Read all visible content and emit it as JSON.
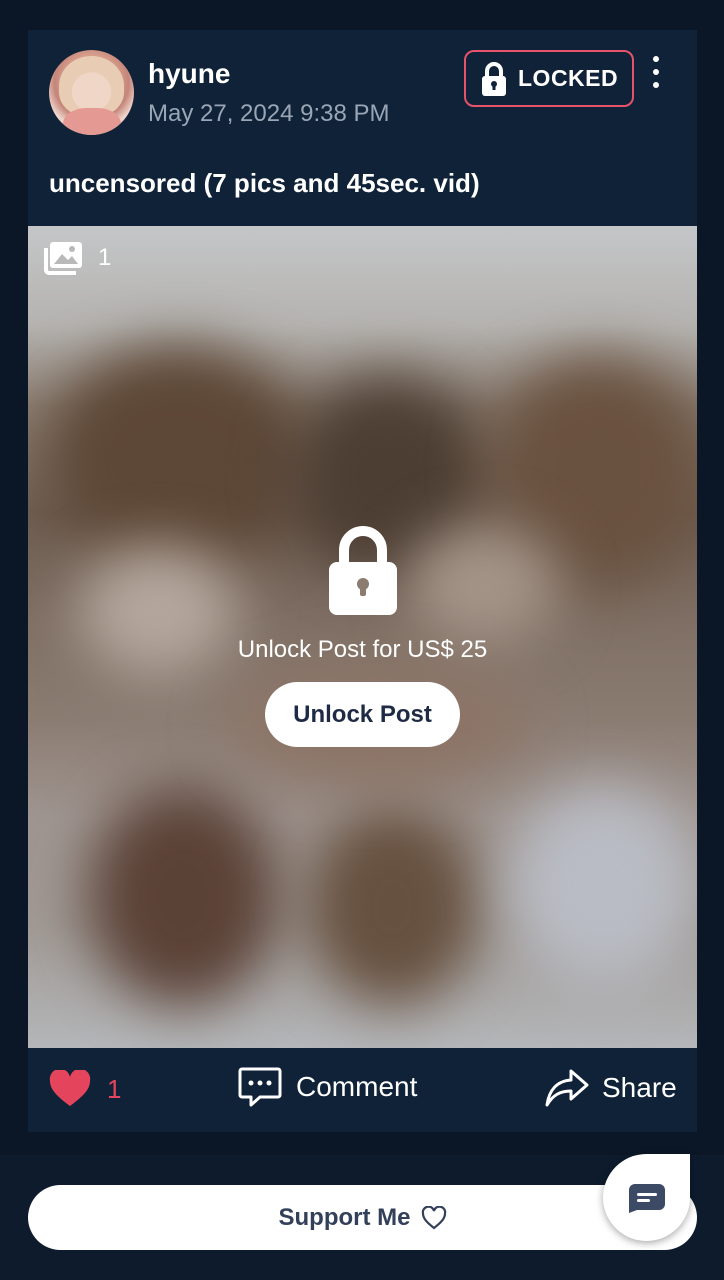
{
  "post": {
    "username": "hyune",
    "date": "May 27, 2024 9:38 PM",
    "locked_label": "LOCKED",
    "caption": "uncensored (7 pics and 45sec. vid)",
    "media_count": "1",
    "unlock_text": "Unlock Post for US$ 25",
    "unlock_button": "Unlock Post"
  },
  "actions": {
    "like_count": "1",
    "comment_label": "Comment",
    "share_label": "Share"
  },
  "footer": {
    "support_label": "Support Me"
  },
  "colors": {
    "background": "#0b1727",
    "card": "#0f2238",
    "accent_red": "#e5455c",
    "locked_border": "#e6536a",
    "chat_icon": "#3d4a66"
  },
  "icons": {
    "locked": "lock-icon",
    "more": "more-vertical-icon",
    "media": "images-icon",
    "unlock": "lock-icon",
    "like": "heart-icon",
    "comment": "comment-icon",
    "share": "share-icon",
    "support": "heart-outline-icon",
    "chat": "chat-icon"
  }
}
